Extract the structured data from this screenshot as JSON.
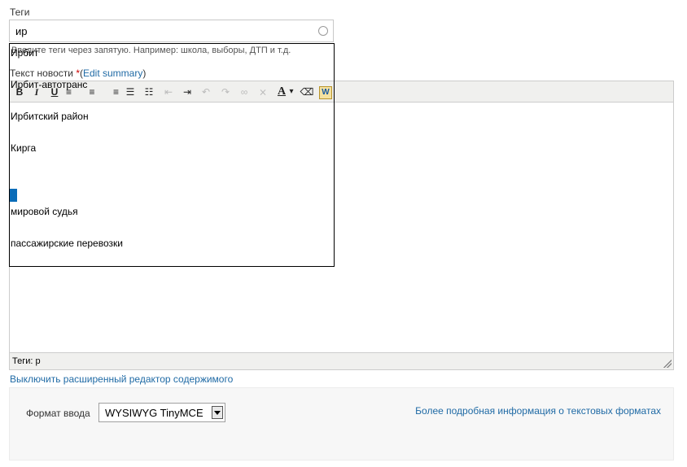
{
  "tags": {
    "label": "Теги",
    "value": "ир",
    "description": "Введите теги через запятую. Например: школа, выборы, ДТП и т.д."
  },
  "body_field": {
    "label": "Текст новости",
    "required_mark": "*",
    "open_paren": "(",
    "edit_summary": "Edit summary",
    "close_paren": ")"
  },
  "toolbar": {
    "bold": "B",
    "italic": "I",
    "underline": "U",
    "align_left": "≡",
    "align_center": "≡",
    "align_right": "≡",
    "bullet_list": "☰",
    "numbered_list": "☷",
    "outdent": "⇤",
    "indent": "⇥",
    "undo": "↶",
    "redo": "↷",
    "link": "∞",
    "unlink": "⨯",
    "font_color": "A",
    "color_dropdown": "▾",
    "eraser": "⌫",
    "paste_word": "W"
  },
  "statusbar": {
    "path": "Теги: p"
  },
  "autocomplete": {
    "items": [
      "Ирбит",
      "Ирбит-автотранс",
      "Ирбитский район",
      "Кирга",
      "мировой судья",
      "пассажирские перевозки"
    ],
    "selected_index": 4
  },
  "disable_editor_link": "Выключить расширенный редактор содержимого",
  "filter": {
    "label": "Формат ввода",
    "selected": "WYSIWYG TinyMCE",
    "more_info": "Более подробная информация о текстовых форматах"
  },
  "colors": {
    "link": "#1f6aa5",
    "required": "#cc0000",
    "selection": "#0a6cb8",
    "toolbar_bg": "#f0f0ee"
  }
}
